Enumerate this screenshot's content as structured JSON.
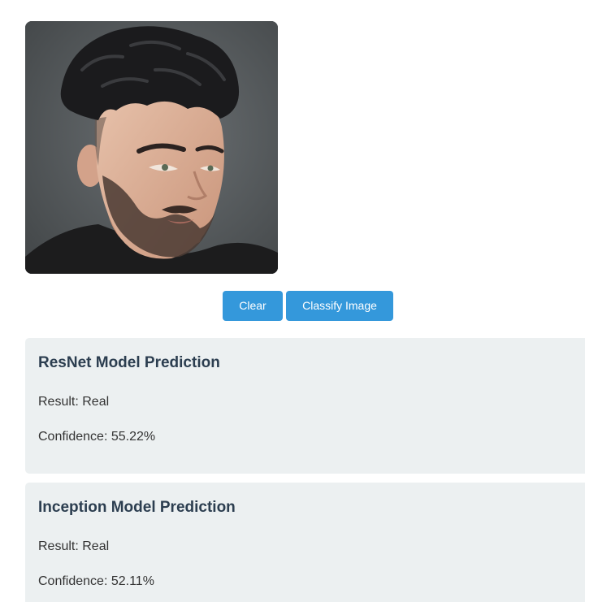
{
  "image": {
    "alt": "Uploaded portrait photo",
    "icon": "portrait-image"
  },
  "actions": {
    "clear_label": "Clear",
    "classify_label": "Classify Image"
  },
  "results": [
    {
      "title": "ResNet Model Prediction",
      "result": "Result: Real",
      "confidence": "Confidence: 55.22%"
    },
    {
      "title": "Inception Model Prediction",
      "result": "Result: Real",
      "confidence": "Confidence: 52.11%"
    }
  ],
  "colors": {
    "button": "#3498db",
    "card_bg": "#ecf0f1",
    "heading": "#2c3e50"
  }
}
